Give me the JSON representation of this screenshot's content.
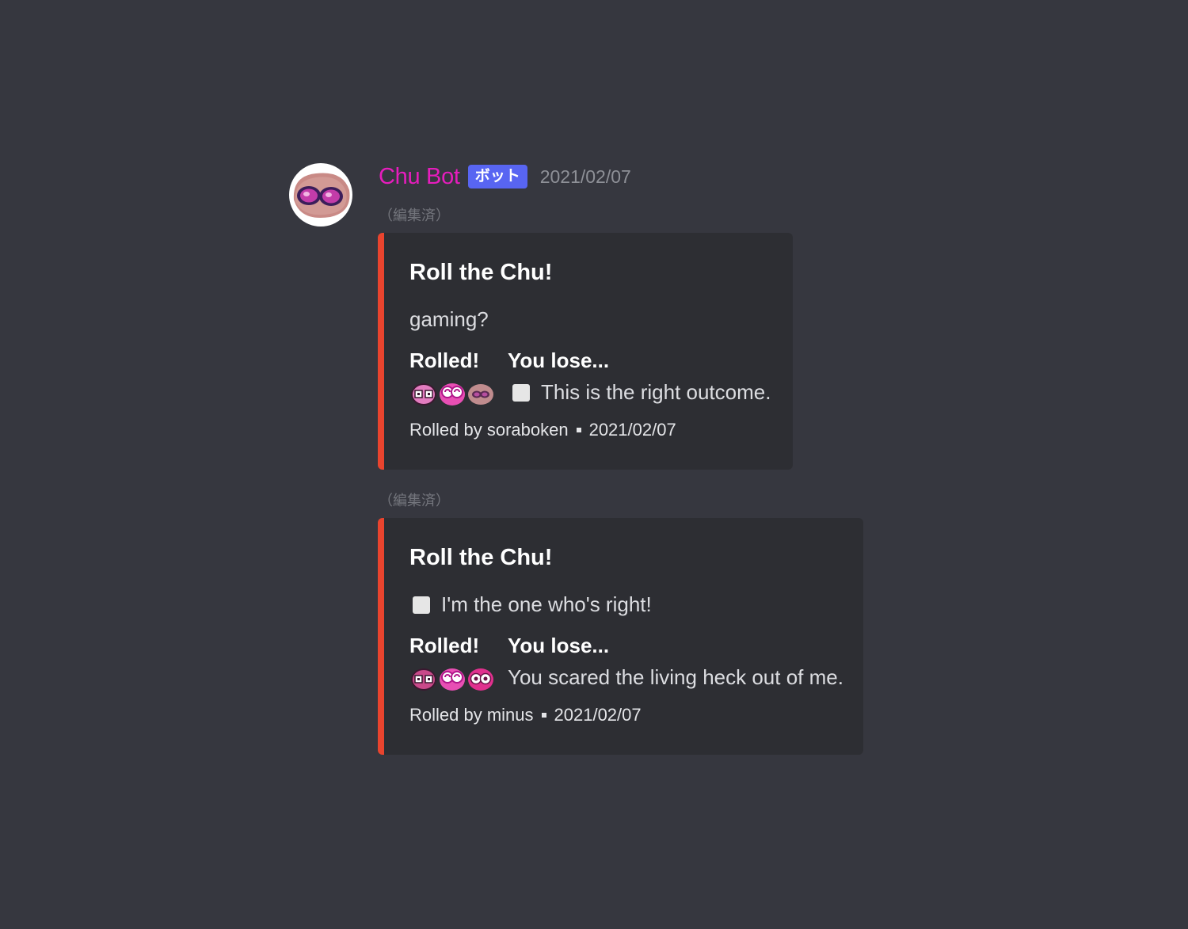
{
  "message": {
    "author": "Chu Bot",
    "bot_tag": "ボット",
    "timestamp": "2021/02/07",
    "author_color": "#e61dbd",
    "accent": "#e9442e"
  },
  "embeds": [
    {
      "edited": "（編集済）",
      "title": "Roll the Chu!",
      "description": "gaming?",
      "field_rolled_name": "Rolled!",
      "field_result_name": "You lose...",
      "result_text": "This is the right outcome.",
      "emojis": [
        "chu-face-dotted-eyes-icon",
        "chu-face-spiral-eyes-icon",
        "chu-face-pale-icon"
      ],
      "footer_user": "Rolled by soraboken",
      "footer_date": "2021/02/07"
    },
    {
      "edited": "（編集済）",
      "title": "Roll the Chu!",
      "description": "I'm the one who's right!",
      "field_rolled_name": "Rolled!",
      "field_result_name": "You lose...",
      "result_text": "You scared the living heck out of me.",
      "emojis": [
        "chu-face-dotted-eyes-icon",
        "chu-face-spiral-eyes-icon",
        "chu-face-wide-eyes-icon"
      ],
      "footer_user": "Rolled by minus",
      "footer_date": "2021/02/07"
    }
  ]
}
